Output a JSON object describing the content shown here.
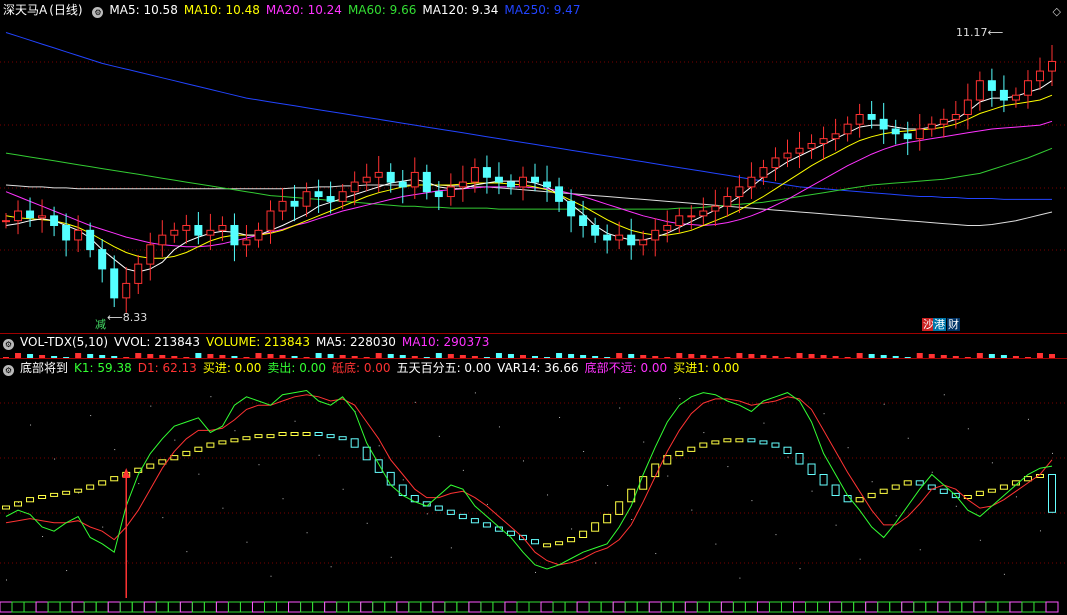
{
  "main_panel": {
    "stock_name": "深天马A",
    "period": "(日线)",
    "mas": [
      {
        "name": "MA5",
        "value": "10.58",
        "color": "#ffffff"
      },
      {
        "name": "MA10",
        "value": "10.48",
        "color": "#ffff00"
      },
      {
        "name": "MA20",
        "value": "10.24",
        "color": "#ff33ff"
      },
      {
        "name": "MA60",
        "value": "9.66",
        "color": "#33dd33"
      },
      {
        "name": "MA120",
        "value": "9.34",
        "color": "#ffffff"
      },
      {
        "name": "MA250",
        "value": "9.47",
        "color": "#2244ff"
      }
    ],
    "high_label": "11.17",
    "low_label": "8.33",
    "badges": [
      {
        "text": "减",
        "bg": "#000000",
        "color": "#44dd66"
      },
      {
        "text": "沙",
        "bg": "#cc2222",
        "color": "#ffffff"
      },
      {
        "text": "港",
        "bg": "#0077aa",
        "color": "#ffffff"
      },
      {
        "text": "财",
        "bg": "#003366",
        "color": "#ffffff"
      }
    ]
  },
  "volume_panel": {
    "title": "VOL-TDX(5,10)",
    "fields": [
      {
        "label": "VVOL",
        "value": "213843",
        "color": "#ffffff"
      },
      {
        "label": "VOLUME",
        "value": "213843",
        "color": "#ffff00"
      },
      {
        "label": "MA5",
        "value": "228030",
        "color": "#ffffff"
      },
      {
        "label": "MA10",
        "value": "290373",
        "color": "#ff33ff"
      }
    ]
  },
  "indicator_panel": {
    "title": "底部将到",
    "fields": [
      {
        "label": "K1",
        "value": "59.38",
        "color": "#33ff33"
      },
      {
        "label": "D1",
        "value": "62.13",
        "color": "#ff3333"
      },
      {
        "label": "买进",
        "value": "0.00",
        "color": "#ffff00"
      },
      {
        "label": "卖出",
        "value": "0.00",
        "color": "#33ff33"
      },
      {
        "label": "砥底",
        "value": "0.00",
        "color": "#ff3333"
      },
      {
        "label": "五天百分五",
        "value": "0.00",
        "color": "#ffffff"
      },
      {
        "label": "VAR14",
        "value": "36.66",
        "color": "#ffffff"
      },
      {
        "label": "底部不远",
        "value": "0.00",
        "color": "#ff33ff"
      },
      {
        "label": "买进1",
        "value": "0.00",
        "color": "#ffff00"
      }
    ]
  },
  "chart_data": {
    "type": "line",
    "x_count": 88,
    "price_close": [
      9.25,
      9.35,
      9.28,
      9.3,
      9.2,
      9.05,
      9.15,
      8.95,
      8.75,
      8.45,
      8.6,
      8.8,
      9.0,
      9.1,
      9.15,
      9.2,
      9.1,
      9.15,
      9.2,
      9.0,
      9.05,
      9.15,
      9.35,
      9.45,
      9.4,
      9.55,
      9.5,
      9.45,
      9.55,
      9.65,
      9.7,
      9.75,
      9.65,
      9.6,
      9.75,
      9.55,
      9.5,
      9.6,
      9.65,
      9.8,
      9.7,
      9.65,
      9.6,
      9.7,
      9.65,
      9.6,
      9.45,
      9.3,
      9.2,
      9.1,
      9.05,
      9.1,
      9.0,
      9.05,
      9.15,
      9.2,
      9.3,
      9.3,
      9.35,
      9.4,
      9.5,
      9.6,
      9.7,
      9.8,
      9.9,
      9.95,
      10.0,
      10.05,
      10.1,
      10.15,
      10.25,
      10.35,
      10.3,
      10.2,
      10.15,
      10.1,
      10.2,
      10.25,
      10.3,
      10.35,
      10.5,
      10.7,
      10.6,
      10.5,
      10.55,
      10.7,
      10.8,
      10.9
    ],
    "ma5": [
      9.2,
      9.22,
      9.25,
      9.27,
      9.25,
      9.2,
      9.15,
      9.07,
      8.95,
      8.85,
      8.75,
      8.72,
      8.75,
      8.82,
      8.95,
      9.03,
      9.08,
      9.12,
      9.14,
      9.13,
      9.1,
      9.1,
      9.15,
      9.2,
      9.26,
      9.32,
      9.4,
      9.44,
      9.48,
      9.52,
      9.56,
      9.6,
      9.64,
      9.66,
      9.68,
      9.65,
      9.6,
      9.58,
      9.58,
      9.62,
      9.64,
      9.66,
      9.66,
      9.66,
      9.64,
      9.6,
      9.52,
      9.42,
      9.32,
      9.2,
      9.12,
      9.08,
      9.05,
      9.05,
      9.08,
      9.12,
      9.18,
      9.24,
      9.3,
      9.36,
      9.42,
      9.5,
      9.6,
      9.7,
      9.78,
      9.86,
      9.92,
      9.98,
      10.04,
      10.1,
      10.16,
      10.22,
      10.24,
      10.24,
      10.22,
      10.2,
      10.2,
      10.22,
      10.26,
      10.3,
      10.38,
      10.48,
      10.52,
      10.52,
      10.54,
      10.58,
      10.62,
      10.7
    ],
    "ma10": [
      9.3,
      9.28,
      9.27,
      9.26,
      9.25,
      9.22,
      9.18,
      9.12,
      9.05,
      8.98,
      8.92,
      8.88,
      8.86,
      8.86,
      8.88,
      8.92,
      8.98,
      9.04,
      9.08,
      9.1,
      9.1,
      9.1,
      9.12,
      9.15,
      9.2,
      9.25,
      9.3,
      9.35,
      9.4,
      9.45,
      9.5,
      9.54,
      9.57,
      9.6,
      9.62,
      9.62,
      9.62,
      9.62,
      9.63,
      9.64,
      9.64,
      9.64,
      9.63,
      9.62,
      9.6,
      9.57,
      9.52,
      9.46,
      9.4,
      9.33,
      9.26,
      9.2,
      9.15,
      9.12,
      9.1,
      9.1,
      9.12,
      9.15,
      9.2,
      9.25,
      9.3,
      9.36,
      9.43,
      9.5,
      9.58,
      9.66,
      9.74,
      9.82,
      9.89,
      9.95,
      10.02,
      10.08,
      10.12,
      10.15,
      10.17,
      10.18,
      10.19,
      10.2,
      10.22,
      10.25,
      10.3,
      10.36,
      10.4,
      10.44,
      10.46,
      10.48,
      10.5,
      10.55
    ],
    "ma20": [
      9.55,
      9.5,
      9.45,
      9.4,
      9.35,
      9.3,
      9.25,
      9.2,
      9.16,
      9.12,
      9.08,
      9.05,
      9.02,
      9.0,
      8.99,
      8.98,
      8.98,
      8.99,
      9.01,
      9.04,
      9.07,
      9.1,
      9.13,
      9.16,
      9.2,
      9.23,
      9.27,
      9.31,
      9.35,
      9.38,
      9.41,
      9.44,
      9.47,
      9.5,
      9.52,
      9.54,
      9.56,
      9.57,
      9.58,
      9.59,
      9.6,
      9.6,
      9.6,
      9.6,
      9.59,
      9.58,
      9.56,
      9.53,
      9.5,
      9.46,
      9.42,
      9.38,
      9.34,
      9.3,
      9.27,
      9.24,
      9.22,
      9.21,
      9.2,
      9.21,
      9.23,
      9.26,
      9.3,
      9.35,
      9.41,
      9.47,
      9.54,
      9.61,
      9.68,
      9.75,
      9.82,
      9.88,
      9.94,
      9.99,
      10.03,
      10.06,
      10.08,
      10.1,
      10.12,
      10.14,
      10.16,
      10.18,
      10.2,
      10.21,
      10.22,
      10.23,
      10.24,
      10.28
    ],
    "ma60": [
      9.95,
      9.93,
      9.91,
      9.89,
      9.87,
      9.85,
      9.83,
      9.81,
      9.79,
      9.77,
      9.75,
      9.73,
      9.71,
      9.69,
      9.67,
      9.65,
      9.63,
      9.61,
      9.59,
      9.57,
      9.55,
      9.53,
      9.51,
      9.5,
      9.49,
      9.48,
      9.47,
      9.46,
      9.45,
      9.44,
      9.43,
      9.42,
      9.41,
      9.4,
      9.4,
      9.39,
      9.39,
      9.38,
      9.38,
      9.38,
      9.38,
      9.37,
      9.37,
      9.37,
      9.37,
      9.37,
      9.37,
      9.37,
      9.37,
      9.37,
      9.37,
      9.37,
      9.37,
      9.37,
      9.37,
      9.37,
      9.38,
      9.38,
      9.39,
      9.4,
      9.41,
      9.42,
      9.43,
      9.44,
      9.46,
      9.48,
      9.5,
      9.52,
      9.54,
      9.56,
      9.58,
      9.6,
      9.62,
      9.63,
      9.64,
      9.65,
      9.66,
      9.67,
      9.68,
      9.7,
      9.72,
      9.74,
      9.78,
      9.82,
      9.86,
      9.9,
      9.95,
      10.0
    ],
    "ma250": [
      11.2,
      11.16,
      11.12,
      11.08,
      11.04,
      11.0,
      10.96,
      10.92,
      10.88,
      10.85,
      10.82,
      10.79,
      10.76,
      10.73,
      10.7,
      10.67,
      10.64,
      10.61,
      10.58,
      10.55,
      10.52,
      10.5,
      10.48,
      10.46,
      10.44,
      10.42,
      10.4,
      10.38,
      10.36,
      10.34,
      10.32,
      10.3,
      10.28,
      10.26,
      10.24,
      10.22,
      10.2,
      10.18,
      10.16,
      10.14,
      10.12,
      10.1,
      10.08,
      10.06,
      10.04,
      10.02,
      10.0,
      9.98,
      9.96,
      9.94,
      9.92,
      9.9,
      9.88,
      9.86,
      9.84,
      9.82,
      9.8,
      9.78,
      9.76,
      9.74,
      9.72,
      9.7,
      9.68,
      9.66,
      9.64,
      9.62,
      9.6,
      9.59,
      9.58,
      9.57,
      9.56,
      9.55,
      9.54,
      9.53,
      9.52,
      9.51,
      9.5,
      9.5,
      9.49,
      9.49,
      9.48,
      9.48,
      9.48,
      9.47,
      9.47,
      9.47,
      9.47,
      9.47
    ],
    "ma120": [
      9.62,
      9.61,
      9.6,
      9.6,
      9.59,
      9.59,
      9.58,
      9.58,
      9.58,
      9.58,
      9.58,
      9.58,
      9.58,
      9.58,
      9.58,
      9.58,
      9.58,
      9.58,
      9.58,
      9.58,
      9.58,
      9.58,
      9.58,
      9.58,
      9.59,
      9.59,
      9.6,
      9.6,
      9.61,
      9.61,
      9.62,
      9.62,
      9.62,
      9.62,
      9.62,
      9.62,
      9.62,
      9.61,
      9.61,
      9.6,
      9.6,
      9.59,
      9.58,
      9.57,
      9.56,
      9.55,
      9.54,
      9.53,
      9.52,
      9.51,
      9.5,
      9.49,
      9.48,
      9.47,
      9.46,
      9.45,
      9.44,
      9.43,
      9.42,
      9.41,
      9.4,
      9.39,
      9.38,
      9.37,
      9.36,
      9.35,
      9.34,
      9.33,
      9.32,
      9.31,
      9.3,
      9.29,
      9.28,
      9.27,
      9.26,
      9.25,
      9.24,
      9.23,
      9.22,
      9.21,
      9.2,
      9.2,
      9.21,
      9.23,
      9.25,
      9.28,
      9.31,
      9.34
    ],
    "k1": [
      35,
      38,
      36,
      30,
      28,
      32,
      35,
      25,
      22,
      18,
      40,
      55,
      65,
      72,
      78,
      80,
      82,
      75,
      78,
      88,
      92,
      90,
      88,
      93,
      94,
      95,
      90,
      88,
      92,
      85,
      70,
      60,
      50,
      45,
      42,
      40,
      45,
      50,
      48,
      40,
      35,
      30,
      25,
      18,
      12,
      10,
      12,
      15,
      18,
      20,
      22,
      30,
      40,
      55,
      68,
      80,
      88,
      92,
      94,
      93,
      90,
      88,
      85,
      90,
      92,
      94,
      90,
      80,
      65,
      55,
      45,
      38,
      30,
      25,
      32,
      40,
      48,
      55,
      50,
      45,
      38,
      35,
      40,
      45,
      50,
      55,
      58,
      59
    ],
    "d1": [
      32,
      33,
      34,
      33,
      32,
      32,
      33,
      30,
      28,
      24,
      30,
      38,
      48,
      58,
      66,
      72,
      76,
      76,
      77,
      81,
      86,
      88,
      88,
      90,
      92,
      93,
      92,
      90,
      91,
      88,
      80,
      72,
      62,
      55,
      48,
      44,
      44,
      46,
      47,
      44,
      40,
      35,
      30,
      25,
      18,
      14,
      12,
      13,
      15,
      18,
      20,
      24,
      31,
      42,
      54,
      66,
      76,
      84,
      89,
      91,
      91,
      90,
      88,
      89,
      90,
      92,
      91,
      86,
      76,
      66,
      56,
      47,
      38,
      31,
      31,
      35,
      41,
      48,
      50,
      48,
      43,
      39,
      40,
      43,
      47,
      51,
      55,
      62
    ],
    "var14": [
      40,
      42,
      44,
      45,
      46,
      47,
      48,
      50,
      52,
      54,
      56,
      58,
      60,
      62,
      64,
      66,
      68,
      70,
      71,
      72,
      73,
      74,
      74,
      75,
      75,
      75,
      74,
      73,
      72,
      68,
      62,
      56,
      50,
      45,
      42,
      40,
      38,
      36,
      34,
      32,
      30,
      28,
      26,
      24,
      22,
      22,
      23,
      25,
      28,
      32,
      36,
      42,
      48,
      54,
      60,
      64,
      66,
      68,
      70,
      71,
      72,
      72,
      71,
      70,
      68,
      65,
      60,
      55,
      50,
      45,
      42,
      44,
      46,
      48,
      50,
      52,
      50,
      48,
      46,
      44,
      45,
      47,
      48,
      50,
      52,
      54,
      55,
      37
    ]
  }
}
